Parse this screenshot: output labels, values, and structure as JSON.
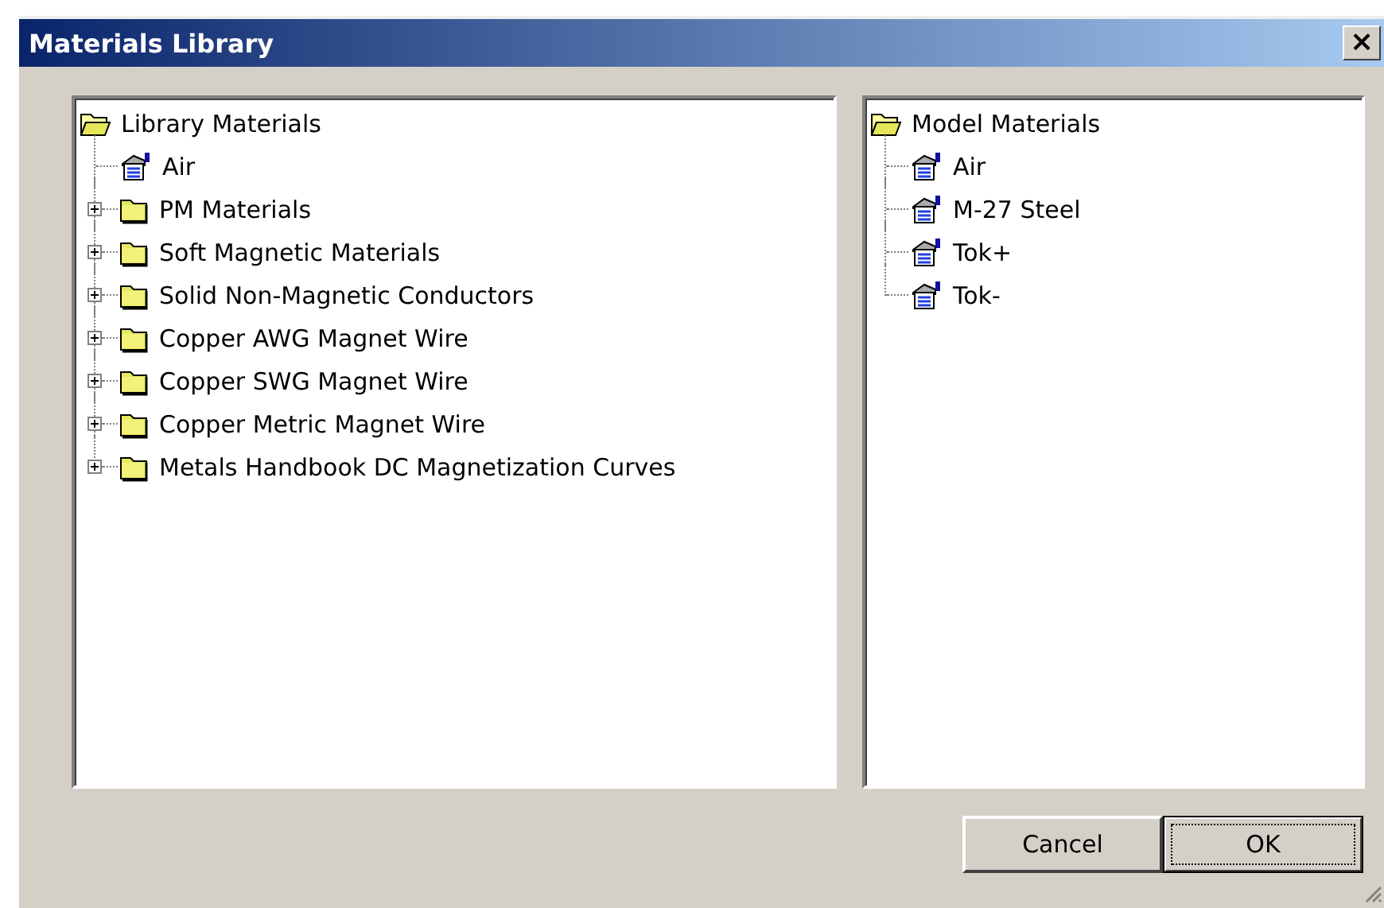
{
  "window": {
    "title": "Materials Library",
    "close": "×"
  },
  "library_tree": {
    "label": "Library Materials",
    "expanded": true,
    "children": [
      {
        "label": "Air",
        "kind": "material"
      },
      {
        "label": "PM Materials",
        "kind": "folder",
        "expanded": false
      },
      {
        "label": "Soft Magnetic Materials",
        "kind": "folder",
        "expanded": false
      },
      {
        "label": "Solid Non-Magnetic Conductors",
        "kind": "folder",
        "expanded": false
      },
      {
        "label": "Copper AWG Magnet Wire",
        "kind": "folder",
        "expanded": false
      },
      {
        "label": "Copper SWG Magnet Wire",
        "kind": "folder",
        "expanded": false
      },
      {
        "label": "Copper Metric Magnet Wire",
        "kind": "folder",
        "expanded": false
      },
      {
        "label": "Metals Handbook DC Magnetization Curves",
        "kind": "folder",
        "expanded": false
      }
    ]
  },
  "model_tree": {
    "label": "Model Materials",
    "expanded": true,
    "children": [
      {
        "label": "Air",
        "kind": "material"
      },
      {
        "label": "M-27 Steel",
        "kind": "material"
      },
      {
        "label": "Tok+",
        "kind": "material"
      },
      {
        "label": "Tok-",
        "kind": "material"
      }
    ]
  },
  "buttons": [
    {
      "label": "Cancel",
      "default": false
    },
    {
      "label": "OK",
      "default": true
    }
  ]
}
